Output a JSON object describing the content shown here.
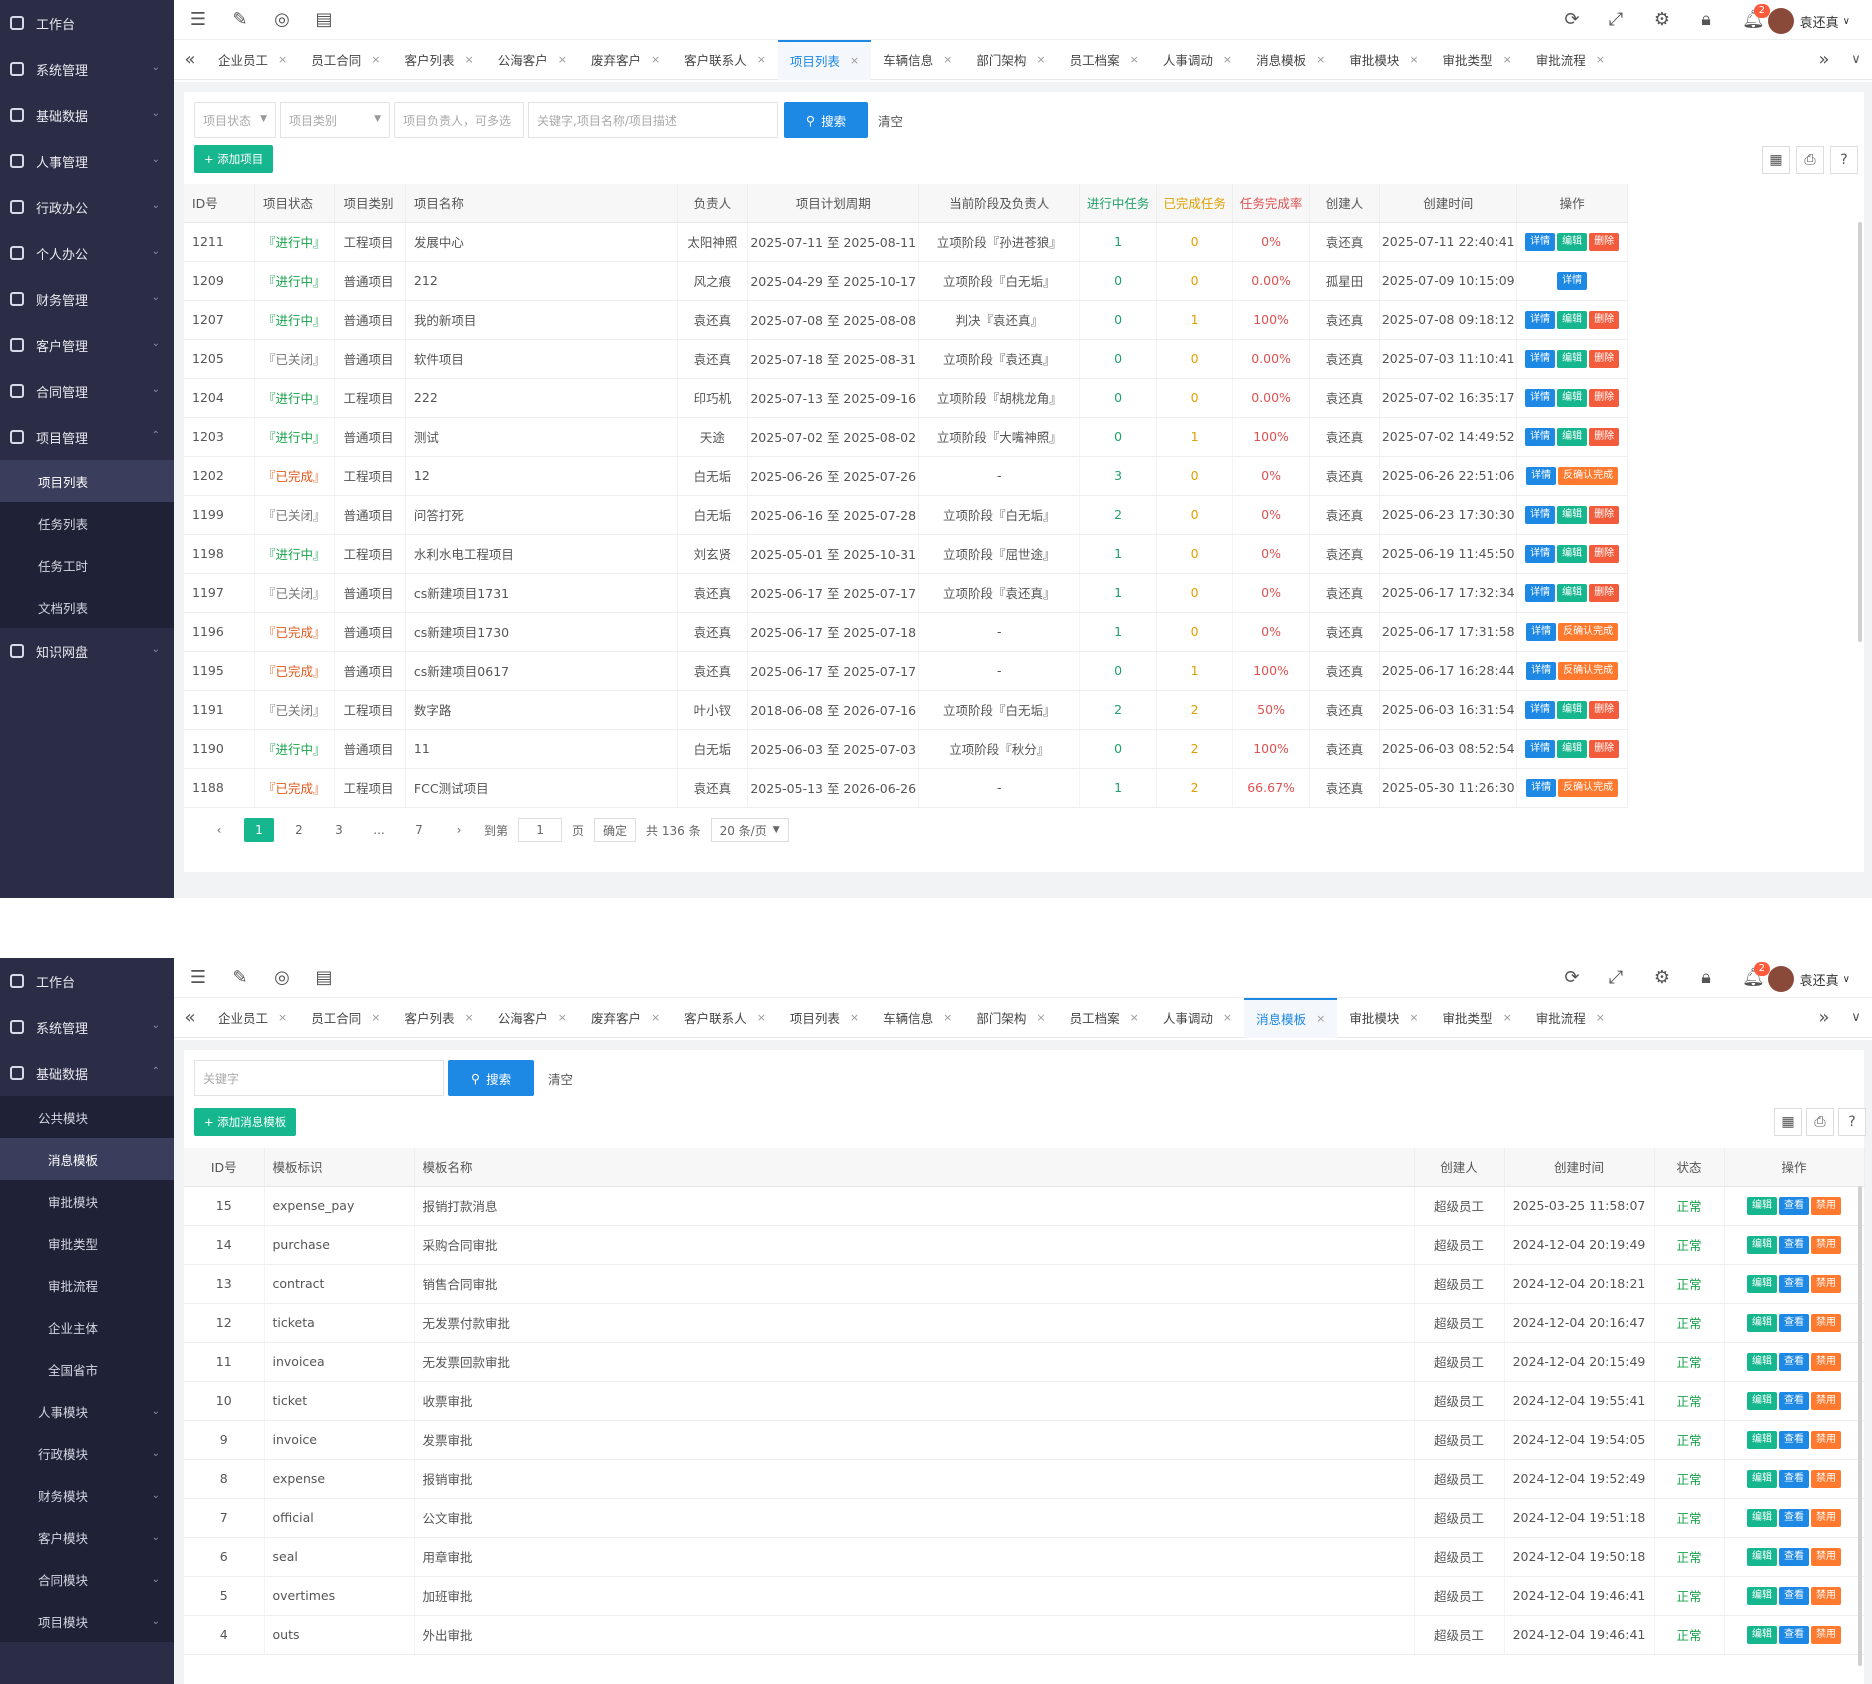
{
  "s1": {
    "sidebar": [
      {
        "label": "工作台",
        "icon": "palette-icon",
        "arrow": ""
      },
      {
        "label": "系统管理",
        "icon": "gear-icon",
        "arrow": "⌄"
      },
      {
        "label": "基础数据",
        "icon": "database-icon",
        "arrow": "⌄"
      },
      {
        "label": "人事管理",
        "icon": "people-icon",
        "arrow": "⌄"
      },
      {
        "label": "行政办公",
        "icon": "office-icon",
        "arrow": "⌄"
      },
      {
        "label": "个人办公",
        "icon": "person-icon",
        "arrow": "⌄"
      },
      {
        "label": "财务管理",
        "icon": "finance-icon",
        "arrow": "⌄"
      },
      {
        "label": "客户管理",
        "icon": "customer-icon",
        "arrow": "⌄"
      },
      {
        "label": "合同管理",
        "icon": "contract-icon",
        "arrow": "⌄"
      },
      {
        "label": "项目管理",
        "icon": "project-icon",
        "arrow": "⌃"
      }
    ],
    "sub": [
      "项目列表",
      "任务列表",
      "任务工时",
      "文档列表"
    ],
    "after": {
      "label": "知识网盘",
      "arrow": "⌄"
    },
    "tabs": [
      "企业员工",
      "员工合同",
      "客户列表",
      "公海客户",
      "废弃客户",
      "客户联系人",
      "项目列表",
      "车辆信息",
      "部门架构",
      "员工档案",
      "人事调动",
      "消息模板",
      "审批模块",
      "审批类型",
      "审批流程"
    ],
    "active_tab": "项目列表",
    "user": "袁还真",
    "badge": "2",
    "filters": [
      "项目状态",
      "项目类别",
      "项目负责人，可多选",
      "关键字,项目名称/项目描述"
    ],
    "search_label": "搜索",
    "clear_label": "清空",
    "add_label": "+ 添加项目",
    "headers": [
      "ID号",
      "项目状态",
      "项目类别",
      "项目名称",
      "负责人",
      "项目计划周期",
      "当前阶段及负责人",
      "进行中任务",
      "已完成任务",
      "任务完成率",
      "创建人",
      "创建时间",
      "操作"
    ],
    "rows": [
      [
        "1211",
        "『进行中』",
        "工程项目",
        "发展中心",
        "太阳神照",
        "2025-07-11 至 2025-08-11",
        "立项阶段『孙进苍狼』",
        "1",
        "0",
        "0%",
        "袁还真",
        "2025-07-11 22:40:41",
        "ops3"
      ],
      [
        "1209",
        "『进行中』",
        "普通项目",
        "212",
        "风之痕",
        "2025-04-29 至 2025-10-17",
        "立项阶段『白无垢』",
        "0",
        "0",
        "0.00%",
        "孤星田",
        "2025-07-09 10:15:09",
        "ops1"
      ],
      [
        "1207",
        "『进行中』",
        "普通项目",
        "我的新项目",
        "袁还真",
        "2025-07-08 至 2025-08-08",
        "判决『袁还真』",
        "0",
        "1",
        "100%",
        "袁还真",
        "2025-07-08 09:18:12",
        "ops3"
      ],
      [
        "1205",
        "『已关闭』",
        "普通项目",
        "软件项目",
        "袁还真",
        "2025-07-18 至 2025-08-31",
        "立项阶段『袁还真』",
        "0",
        "0",
        "0.00%",
        "袁还真",
        "2025-07-03 11:10:41",
        "ops3"
      ],
      [
        "1204",
        "『进行中』",
        "工程项目",
        "222",
        "印巧机",
        "2025-07-13 至 2025-09-16",
        "立项阶段『胡桃龙角』",
        "0",
        "0",
        "0.00%",
        "袁还真",
        "2025-07-02 16:35:17",
        "ops3"
      ],
      [
        "1203",
        "『进行中』",
        "普通项目",
        "测试",
        "天途",
        "2025-07-02 至 2025-08-02",
        "立项阶段『大嘴神照』",
        "0",
        "1",
        "100%",
        "袁还真",
        "2025-07-02 14:49:52",
        "ops3"
      ],
      [
        "1202",
        "『已完成』",
        "工程项目",
        "12",
        "白无垢",
        "2025-06-26 至 2025-07-26",
        "-",
        "3",
        "0",
        "0%",
        "袁还真",
        "2025-06-26 22:51:06",
        "opsc"
      ],
      [
        "1199",
        "『已关闭』",
        "普通项目",
        "问答打死",
        "白无垢",
        "2025-06-16 至 2025-07-28",
        "立项阶段『白无垢』",
        "2",
        "0",
        "0%",
        "袁还真",
        "2025-06-23 17:30:30",
        "ops3"
      ],
      [
        "1198",
        "『进行中』",
        "工程项目",
        "水利水电工程项目",
        "刘玄贤",
        "2025-05-01 至 2025-10-31",
        "立项阶段『屈世途』",
        "1",
        "0",
        "0%",
        "袁还真",
        "2025-06-19 11:45:50",
        "ops3"
      ],
      [
        "1197",
        "『已关闭』",
        "普通项目",
        "cs新建项目1731",
        "袁还真",
        "2025-06-17 至 2025-07-17",
        "立项阶段『袁还真』",
        "1",
        "0",
        "0%",
        "袁还真",
        "2025-06-17 17:32:34",
        "ops3"
      ],
      [
        "1196",
        "『已完成』",
        "普通项目",
        "cs新建项目1730",
        "袁还真",
        "2025-06-17 至 2025-07-18",
        "-",
        "1",
        "0",
        "0%",
        "袁还真",
        "2025-06-17 17:31:58",
        "opsc"
      ],
      [
        "1195",
        "『已完成』",
        "普通项目",
        "cs新建项目0617",
        "袁还真",
        "2025-06-17 至 2025-07-17",
        "-",
        "0",
        "1",
        "100%",
        "袁还真",
        "2025-06-17 16:28:44",
        "opsc"
      ],
      [
        "1191",
        "『已关闭』",
        "工程项目",
        "数字路",
        "叶小钗",
        "2018-06-08 至 2026-07-16",
        "立项阶段『白无垢』",
        "2",
        "2",
        "50%",
        "袁还真",
        "2025-06-03 16:31:54",
        "ops3"
      ],
      [
        "1190",
        "『进行中』",
        "普通项目",
        "11",
        "白无垢",
        "2025-06-03 至 2025-07-03",
        "立项阶段『秋分』",
        "0",
        "2",
        "100%",
        "袁还真",
        "2025-06-03 08:52:54",
        "ops3"
      ],
      [
        "1188",
        "『已完成』",
        "工程项目",
        "FCC测试项目",
        "袁还真",
        "2025-05-13 至 2026-06-26",
        "-",
        "1",
        "2",
        "66.67%",
        "袁还真",
        "2025-05-30 11:26:30",
        "opsc"
      ]
    ],
    "ops": {
      "detail": "详情",
      "edit": "编辑",
      "delete": "删除",
      "confirm": "反确认完成"
    },
    "pager": {
      "pages": [
        "1",
        "2",
        "3",
        "...",
        "7"
      ],
      "goto": "到第",
      "page_input": "1",
      "page_unit": "页",
      "confirm": "确定",
      "total": "共 136 条",
      "per_page": "20 条/页"
    }
  },
  "s2": {
    "sidebar_top": [
      {
        "label": "工作台",
        "arrow": ""
      },
      {
        "label": "系统管理",
        "arrow": "⌄"
      },
      {
        "label": "基础数据",
        "arrow": "⌃"
      }
    ],
    "group": "公共模块",
    "sub": [
      "消息模板",
      "审批模块",
      "审批类型",
      "审批流程",
      "企业主体",
      "全国省市"
    ],
    "groups_after": [
      "人事模块",
      "行政模块",
      "财务模块",
      "客户模块",
      "合同模块",
      "项目模块"
    ],
    "tabs": [
      "企业员工",
      "员工合同",
      "客户列表",
      "公海客户",
      "废弃客户",
      "客户联系人",
      "项目列表",
      "车辆信息",
      "部门架构",
      "员工档案",
      "人事调动",
      "消息模板",
      "审批模块",
      "审批类型",
      "审批流程"
    ],
    "active_tab": "消息模板",
    "user": "袁还真",
    "badge": "2",
    "keyword": "关键字",
    "search_label": "搜索",
    "clear_label": "清空",
    "add_label": "+ 添加消息模板",
    "headers": [
      "ID号",
      "模板标识",
      "模板名称",
      "创建人",
      "创建时间",
      "状态",
      "操作"
    ],
    "rows": [
      [
        "15",
        "expense_pay",
        "报销打款消息",
        "超级员工",
        "2025-03-25 11:58:07",
        "正常"
      ],
      [
        "14",
        "purchase",
        "采购合同审批",
        "超级员工",
        "2024-12-04 20:19:49",
        "正常"
      ],
      [
        "13",
        "contract",
        "销售合同审批",
        "超级员工",
        "2024-12-04 20:18:21",
        "正常"
      ],
      [
        "12",
        "ticketa",
        "无发票付款审批",
        "超级员工",
        "2024-12-04 20:16:47",
        "正常"
      ],
      [
        "11",
        "invoicea",
        "无发票回款审批",
        "超级员工",
        "2024-12-04 20:15:49",
        "正常"
      ],
      [
        "10",
        "ticket",
        "收票审批",
        "超级员工",
        "2024-12-04 19:55:41",
        "正常"
      ],
      [
        "9",
        "invoice",
        "发票审批",
        "超级员工",
        "2024-12-04 19:54:05",
        "正常"
      ],
      [
        "8",
        "expense",
        "报销审批",
        "超级员工",
        "2024-12-04 19:52:49",
        "正常"
      ],
      [
        "7",
        "official",
        "公文审批",
        "超级员工",
        "2024-12-04 19:51:18",
        "正常"
      ],
      [
        "6",
        "seal",
        "用章审批",
        "超级员工",
        "2024-12-04 19:50:18",
        "正常"
      ],
      [
        "5",
        "overtimes",
        "加班审批",
        "超级员工",
        "2024-12-04 19:46:41",
        "正常"
      ],
      [
        "4",
        "outs",
        "外出审批",
        "超级员工",
        "2024-12-04 19:46:41",
        "正常"
      ]
    ],
    "ops": {
      "edit": "编辑",
      "view": "查看",
      "disable": "禁用"
    }
  }
}
